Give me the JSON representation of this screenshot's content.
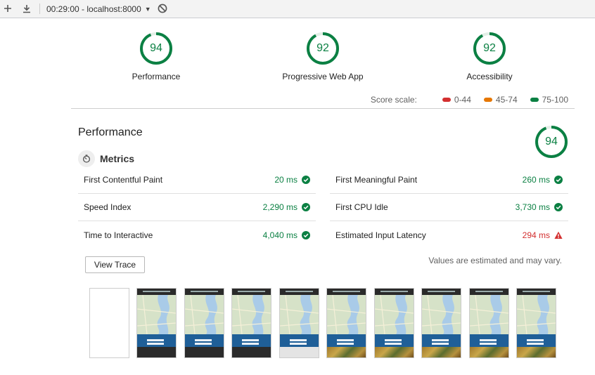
{
  "toolbar": {
    "selector_label": "00:29:00 - localhost:8000",
    "icons": [
      "plus-icon",
      "download-icon",
      "clear-icon"
    ]
  },
  "gauges": [
    {
      "score": "94",
      "label": "Performance",
      "fraction": 0.94
    },
    {
      "score": "92",
      "label": "Progressive Web App",
      "fraction": 0.92
    },
    {
      "score": "92",
      "label": "Accessibility",
      "fraction": 0.92
    }
  ],
  "score_scale": {
    "title": "Score scale:",
    "ranges": [
      {
        "label": "0-44",
        "color": "#d32f2f"
      },
      {
        "label": "45-74",
        "color": "#e67700"
      },
      {
        "label": "75-100",
        "color": "#0b8043"
      }
    ]
  },
  "performance": {
    "title": "Performance",
    "score": "94",
    "fraction": 0.94,
    "metrics_title": "Metrics",
    "metrics_left": [
      {
        "name": "First Contentful Paint",
        "value": "20 ms",
        "status": "pass"
      },
      {
        "name": "Speed Index",
        "value": "2,290 ms",
        "status": "pass"
      },
      {
        "name": "Time to Interactive",
        "value": "4,040 ms",
        "status": "pass"
      }
    ],
    "metrics_right": [
      {
        "name": "First Meaningful Paint",
        "value": "260 ms",
        "status": "pass"
      },
      {
        "name": "First CPU Idle",
        "value": "3,730 ms",
        "status": "pass"
      },
      {
        "name": "Estimated Input Latency",
        "value": "294 ms",
        "status": "fail"
      }
    ],
    "view_trace_label": "View Trace",
    "estimate_note": "Values are estimated and may vary."
  },
  "colors": {
    "pass": "#0b8043",
    "fail": "#d32f2f",
    "gauge_track": "#e3efe7"
  }
}
